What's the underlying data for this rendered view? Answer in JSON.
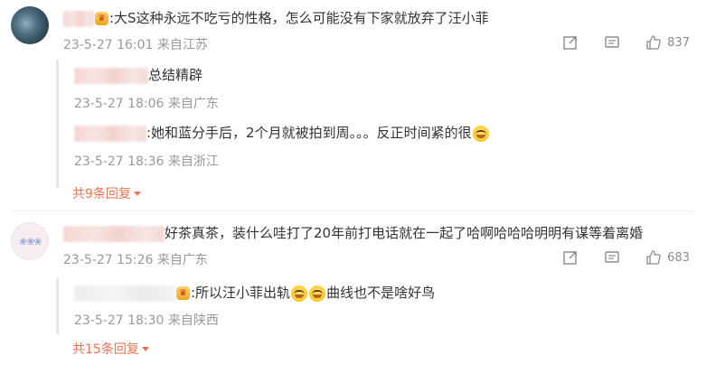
{
  "comments": [
    {
      "text": ":大S这种永远不吃亏的性格，怎么可能没有下家就放弃了汪小菲",
      "time": "23-5-27 16:01",
      "location": "来自江苏",
      "like_count": "837",
      "replies": [
        {
          "text": "总结精辟",
          "time": "23-5-27 18:06",
          "location": "来自广东"
        },
        {
          "text": ":她和蓝分手后，2个月就被拍到周。。。反正时间紧的很",
          "time": "23-5-27 18:36",
          "location": "来自浙江"
        }
      ],
      "more_label": "共9条回复"
    },
    {
      "text": "好茶真茶，装什么哇打了20年前打电话就在一起了哈啊哈哈哈明明有谋等着离婚",
      "time": "23-5-27 15:26",
      "location": "来自广东",
      "like_count": "683",
      "replies": [
        {
          "text_a": ":所以汪小菲出轨",
          "text_b": "曲线也不是啥好鸟",
          "time": "23-5-27 18:30",
          "location": "来自陕西"
        }
      ],
      "more_label": "共15条回复"
    }
  ],
  "icons": {
    "forward": "share-icon",
    "comment": "comment-icon",
    "like": "thumbs-up-icon",
    "emoji": "laughing-emoji-icon"
  },
  "colors": {
    "accent": "#eb7350",
    "meta": "#999999",
    "text": "#333333"
  }
}
